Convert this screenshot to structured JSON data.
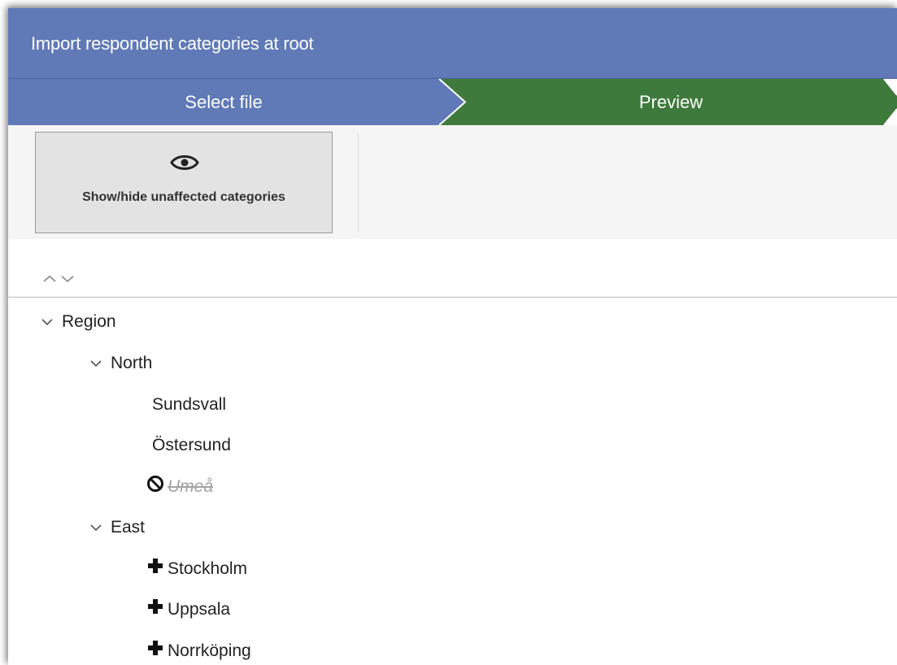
{
  "window": {
    "title": "Import respondent categories at root"
  },
  "wizard": {
    "steps": [
      {
        "label": "Select file",
        "state": "done"
      },
      {
        "label": "Preview",
        "state": "active"
      }
    ],
    "colors": {
      "done": "#6079b7",
      "active": "#3f7a3d"
    }
  },
  "toolbar": {
    "show_hide_label": "Show/hide unaffected categories",
    "show_hide_icon": "eye-icon"
  },
  "tree": {
    "controls": {
      "expand_icon": "chevron-up-icon",
      "collapse_icon": "chevron-down-icon"
    },
    "root": {
      "label": "Region",
      "expanded": true,
      "children": [
        {
          "label": "North",
          "expanded": true,
          "children": [
            {
              "label": "Sundsvall",
              "status": "unchanged"
            },
            {
              "label": "Östersund",
              "status": "unchanged"
            },
            {
              "label": "Umeå",
              "status": "removed",
              "icon": "no-entry-icon"
            }
          ]
        },
        {
          "label": "East",
          "expanded": true,
          "children": [
            {
              "label": "Stockholm",
              "status": "added",
              "icon": "plus-icon"
            },
            {
              "label": "Uppsala",
              "status": "added",
              "icon": "plus-icon"
            },
            {
              "label": "Norrköping",
              "status": "added",
              "icon": "plus-icon"
            }
          ]
        }
      ]
    }
  }
}
